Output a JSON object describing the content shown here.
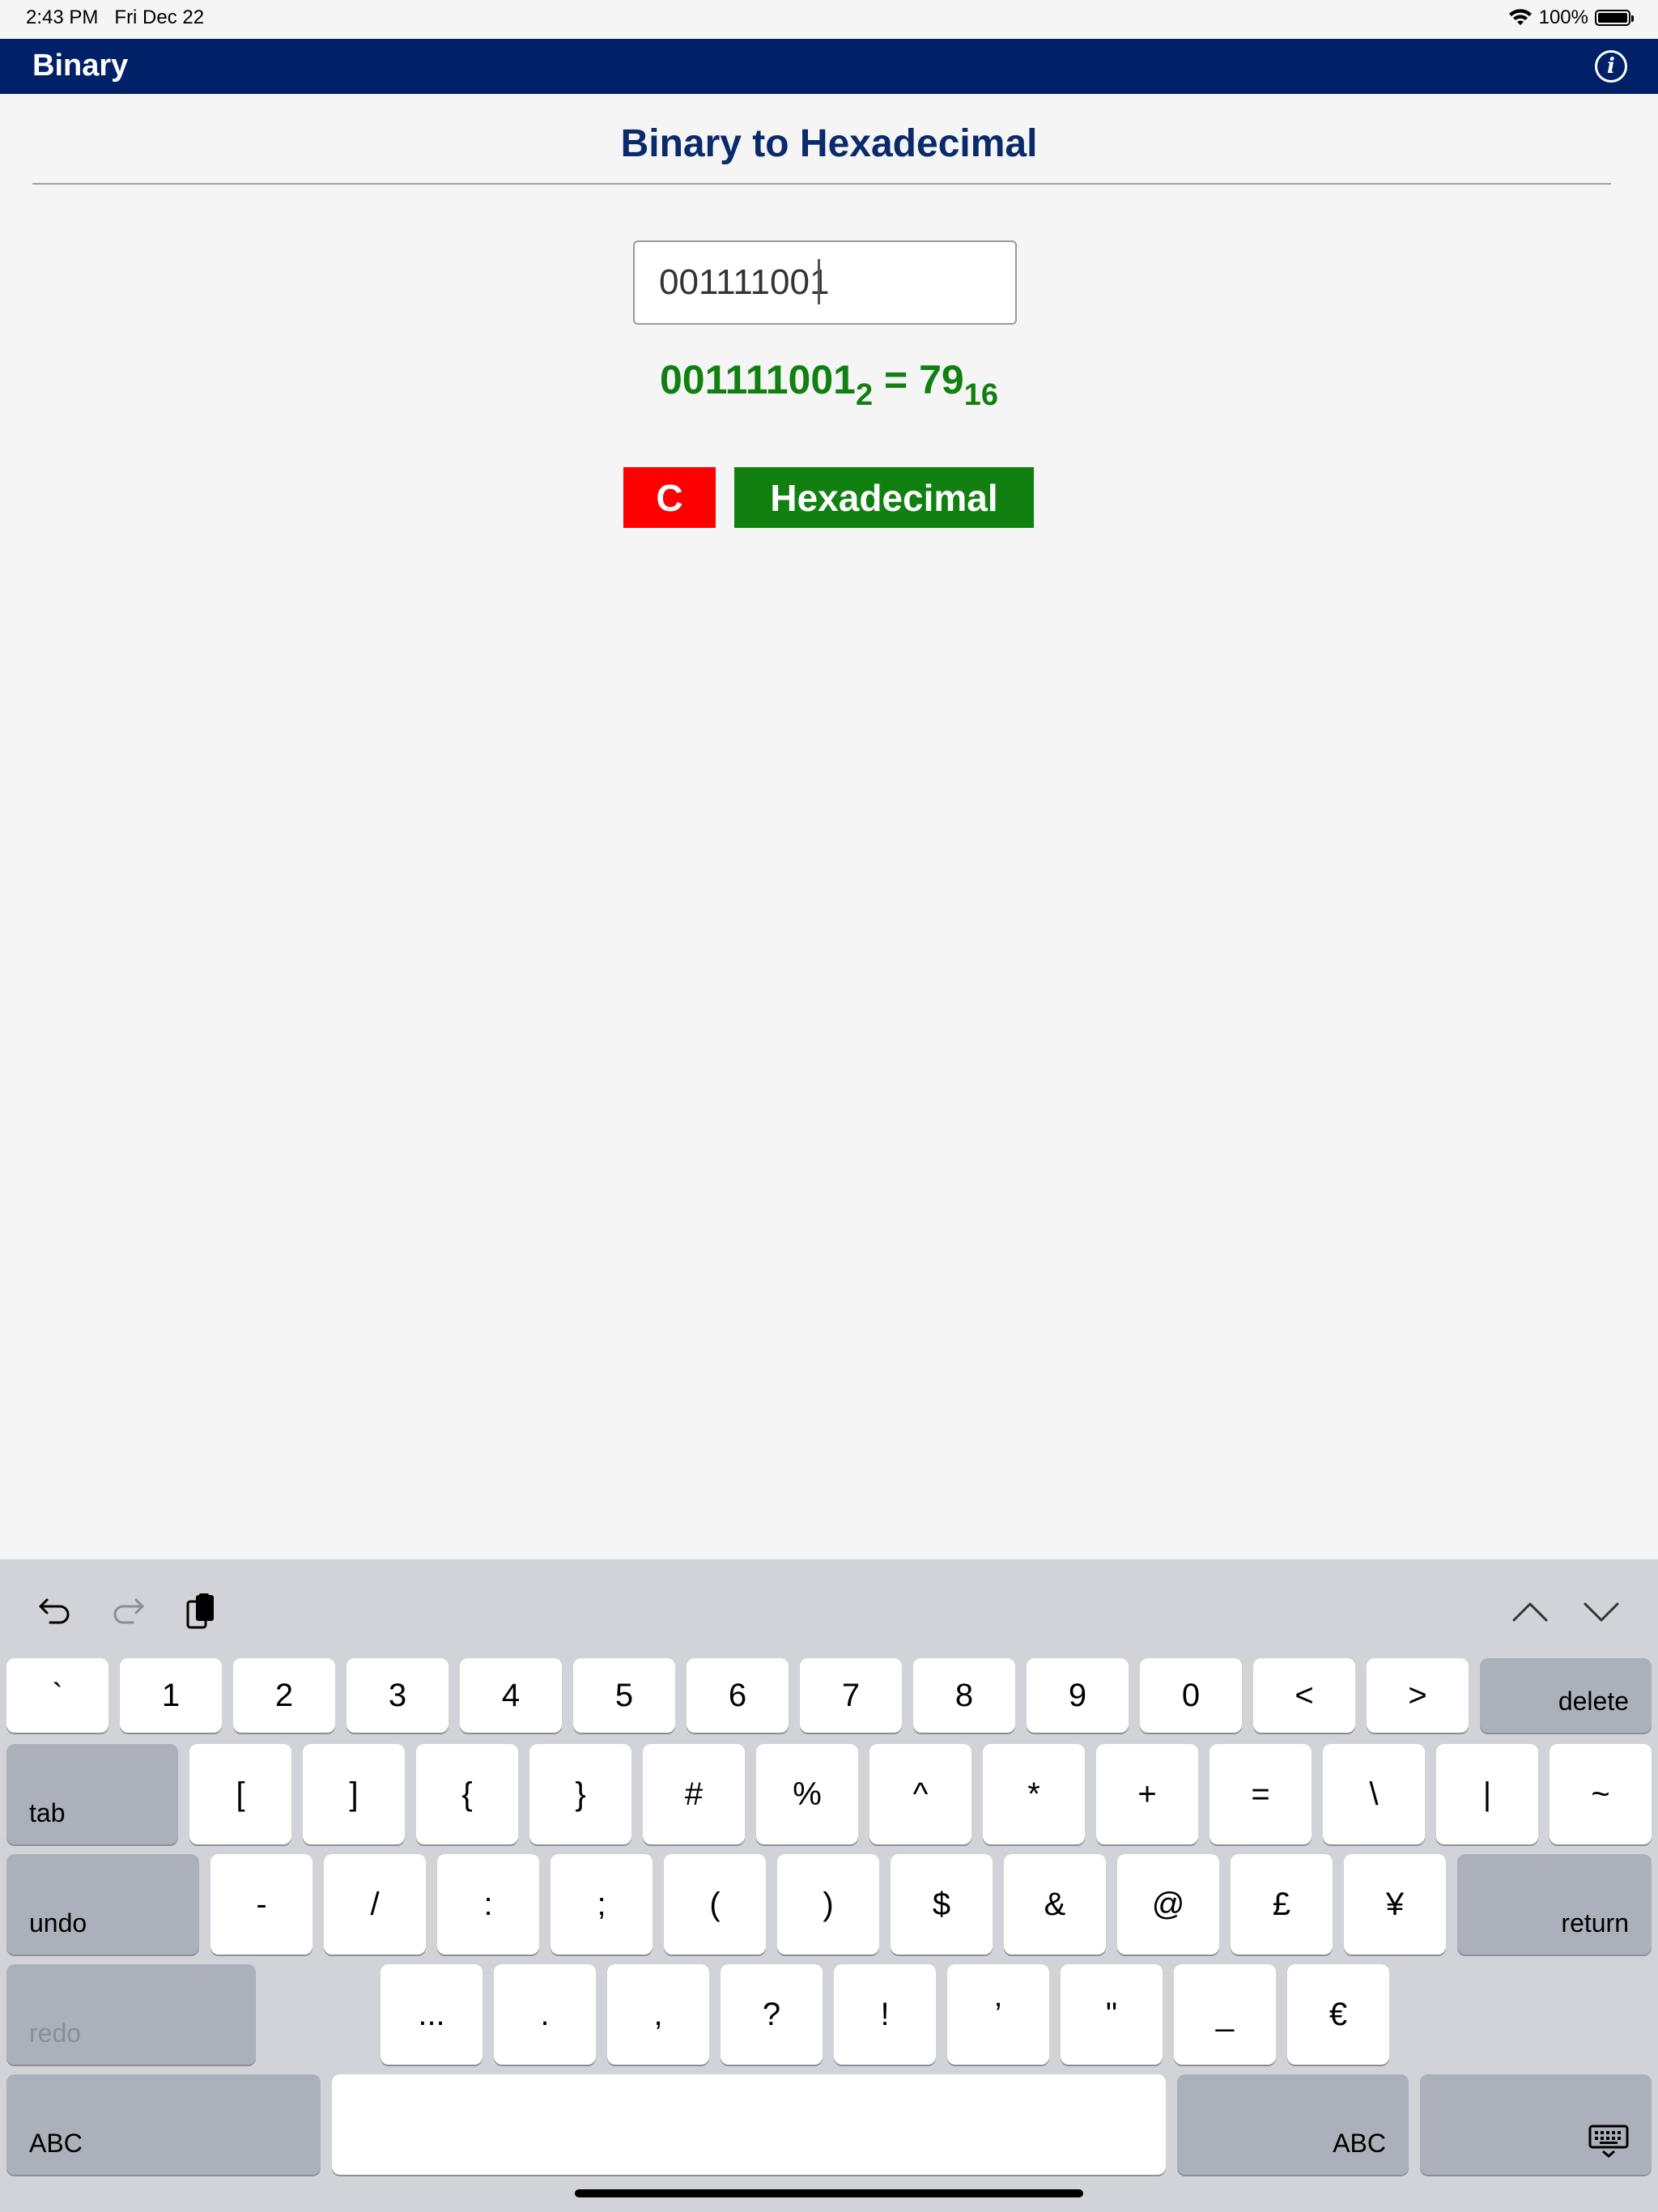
{
  "status_bar": {
    "time": "2:43 PM",
    "date": "Fri Dec 22",
    "battery": "100%",
    "battery_level": 1.0
  },
  "nav": {
    "title": "Binary",
    "info_icon": "info-icon"
  },
  "content": {
    "title": "Binary to Hexadecimal",
    "input_value": "001111001",
    "result": {
      "binary": "001111001",
      "binary_base": "2",
      "equals": " = ",
      "hex": "79",
      "hex_base": "16"
    },
    "clear_label": "C",
    "convert_label": "Hexadecimal"
  },
  "keyboard": {
    "toolbar": {
      "undo_icon": "undo-arrow-icon",
      "redo_icon": "redo-arrow-icon",
      "paste_icon": "clipboard-icon",
      "up_icon": "chevron-up-icon",
      "down_icon": "chevron-down-icon"
    },
    "row1": [
      "`",
      "1",
      "2",
      "3",
      "4",
      "5",
      "6",
      "7",
      "8",
      "9",
      "0",
      "<",
      ">"
    ],
    "row1_delete": "delete",
    "row2_tab": "tab",
    "row2": [
      "[",
      "]",
      "{",
      "}",
      "#",
      "%",
      "^",
      "*",
      "+",
      "=",
      "\\",
      "|",
      "~"
    ],
    "row3_undo": "undo",
    "row3": [
      "-",
      "/",
      ":",
      ";",
      "(",
      ")",
      "$",
      "&",
      "@",
      "£",
      "¥"
    ],
    "row3_return": "return",
    "row4_redo": "redo",
    "row4": [
      "...",
      ".",
      ",",
      "?",
      "!",
      "’",
      "\"",
      "_",
      "€"
    ],
    "row5_abc_left": "ABC",
    "row5_abc_right": "ABC",
    "dismiss_icon": "keyboard-dismiss-icon"
  }
}
